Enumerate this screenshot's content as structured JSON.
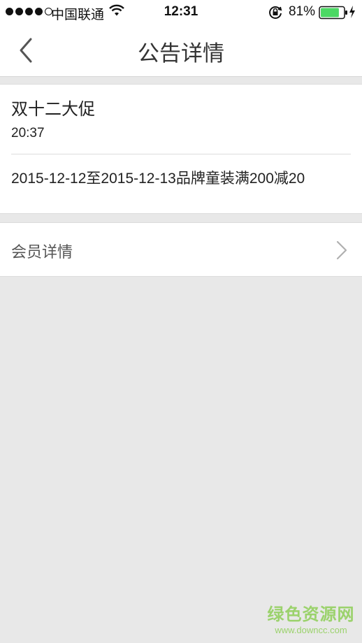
{
  "status_bar": {
    "carrier": "中国联通",
    "time": "12:31",
    "battery_percent": "81%",
    "signal_bars_filled": 4,
    "signal_bars_total": 5,
    "battery_level": 0.81,
    "icons": [
      "signal-dots-icon",
      "wifi-icon",
      "rotation-lock-icon",
      "battery-icon",
      "charging-bolt-icon"
    ]
  },
  "nav": {
    "title": "公告详情",
    "back_icon": "chevron-left-icon"
  },
  "notice": {
    "title": "双十二大促",
    "time": "20:37",
    "content": "2015-12-12至2015-12-13品牌童装满200减20"
  },
  "member": {
    "label": "会员详情",
    "chevron_icon": "chevron-right-icon"
  },
  "watermark": {
    "main": "绿色资源网",
    "url": "www.downcc.com"
  },
  "colors": {
    "background": "#e8e8e8",
    "card": "#ffffff",
    "battery_green": "#4cd964",
    "watermark_green": "#9bd26c"
  }
}
